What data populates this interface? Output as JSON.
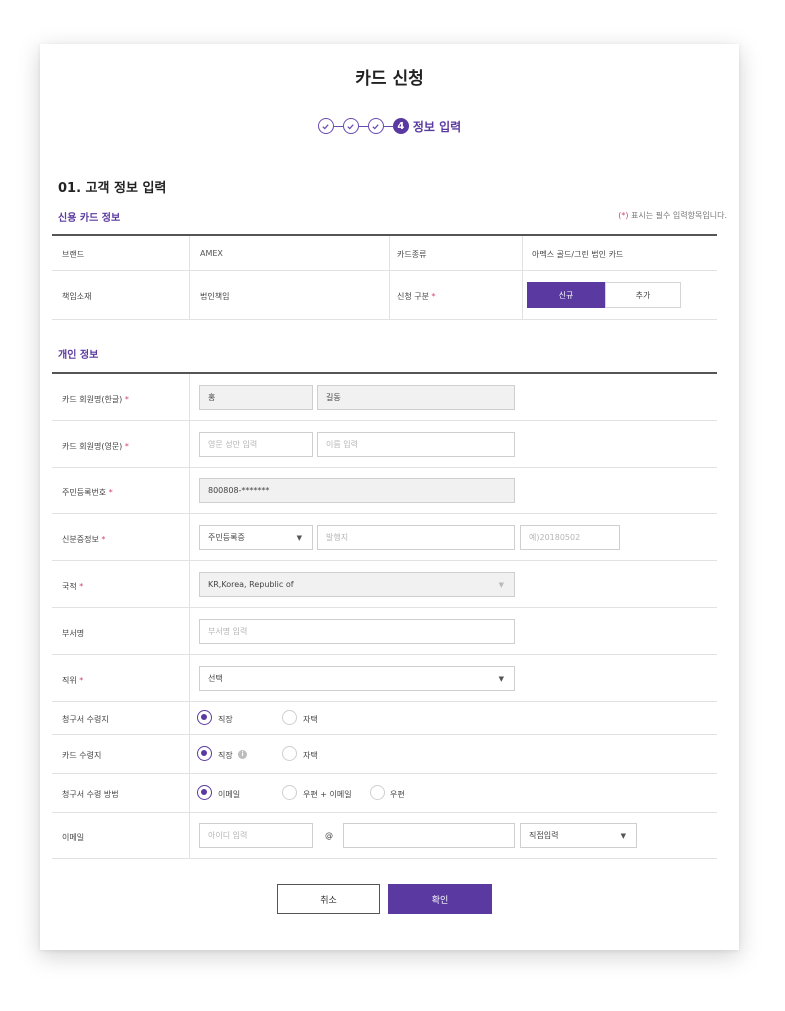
{
  "title": "카드 신청",
  "steps": {
    "current_number": "4",
    "current_label": "정보 입력"
  },
  "section": {
    "title": "01. 고객 정보 입력"
  },
  "credit_card_info": {
    "subtitle": "신용 카드 정보",
    "required_note_star": "(*)",
    "required_note_text": " 표시는 필수 입력항목입니다.",
    "brand_label": "브랜드",
    "brand_value": "AMEX",
    "card_type_label": "카드종류",
    "card_type_value": "아멕스 골드/그린 법인 카드",
    "liability_label": "책임소재",
    "liability_value": "법인책임",
    "apply_type_label": "신청 구분",
    "apply_type_options": [
      "신규",
      "추가"
    ],
    "apply_type_selected": "신규"
  },
  "personal_info": {
    "subtitle": "개인 정보",
    "required_mark": "*",
    "name_kr_label": "카드 회원명(한글)",
    "last_name_kr_value": "홍",
    "first_name_kr_value": "길동",
    "name_en_label": "카드 회원명(영문)",
    "last_name_en_placeholder": "영문 성만 입력",
    "first_name_en_placeholder": "이름 입력",
    "resident_no_label": "주민등록번호",
    "resident_no_value": "800808-*******",
    "id_label": "신분증정보",
    "id_type_value": "주민등록증",
    "issuer_placeholder": "발행지",
    "issue_date_placeholder": "예)20180502",
    "nationality_label": "국적",
    "nationality_value": "KR,Korea, Republic of",
    "department_label": "부서명",
    "department_placeholder": "부서명 입력",
    "position_label": "직위",
    "position_value": "선택",
    "bill_recv_label": "청구서 수령지",
    "bill_recv_options": [
      "직장",
      "자택"
    ],
    "bill_recv_selected": "직장",
    "card_recv_label": "카드 수령지",
    "card_recv_options": [
      "직장",
      "자택"
    ],
    "card_recv_selected": "직장",
    "bill_method_label": "청구서 수령 방법",
    "bill_method_options": [
      "이메일",
      "우편 + 이메일",
      "우편"
    ],
    "bill_method_selected": "이메일",
    "email_label": "이메일",
    "email_id_placeholder": "아이디 입력",
    "email_at": "@",
    "email_domain_value": "",
    "email_domain_select": "직접입력"
  },
  "buttons": {
    "cancel": "취소",
    "confirm": "확인"
  },
  "colors": {
    "accent": "#5a3aa0",
    "required": "#d0427a"
  },
  "icons": [
    "check-circle-icon",
    "chevron-down-icon",
    "info-icon",
    "radio-icon"
  ]
}
